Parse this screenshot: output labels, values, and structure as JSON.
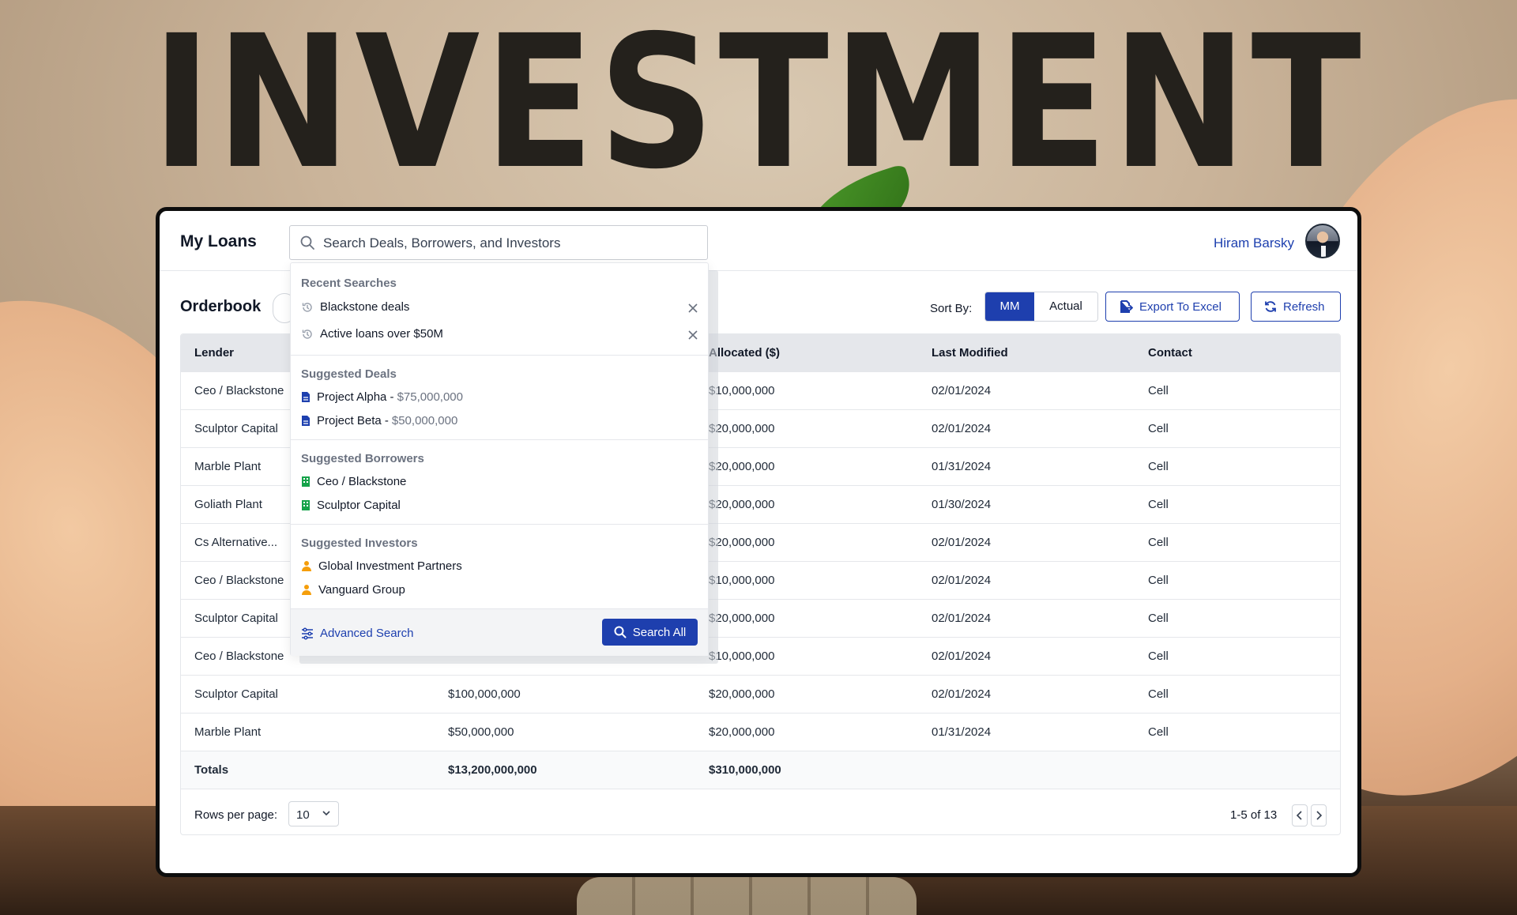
{
  "background": {
    "headline": "INVESTMENT"
  },
  "header": {
    "app_title": "My Loans",
    "search_placeholder": "Search Deals, Borrowers, and Investors",
    "user_name": "Hiram Barsky"
  },
  "toolbar": {
    "section_title": "Orderbook",
    "sort_label": "Sort By:",
    "sort_options": [
      "MM",
      "Actual"
    ],
    "sort_selected": "MM",
    "export_label": "Export To Excel",
    "refresh_label": "Refresh"
  },
  "table": {
    "columns": [
      "Lender",
      "",
      "Allocated ($)",
      "Last Modified",
      "Contact"
    ],
    "rows": [
      [
        "Ceo / Blackstone",
        "",
        "$10,000,000",
        "02/01/2024",
        "Cell"
      ],
      [
        "Sculptor Capital",
        "",
        "$20,000,000",
        "02/01/2024",
        "Cell"
      ],
      [
        "Marble Plant",
        "",
        "$20,000,000",
        "01/31/2024",
        "Cell"
      ],
      [
        "Goliath Plant",
        "",
        "$20,000,000",
        "01/30/2024",
        "Cell"
      ],
      [
        "Cs Alternative...",
        "",
        "$20,000,000",
        "02/01/2024",
        "Cell"
      ],
      [
        "Ceo / Blackstone",
        "",
        "$10,000,000",
        "02/01/2024",
        "Cell"
      ],
      [
        "Sculptor Capital",
        "",
        "$20,000,000",
        "02/01/2024",
        "Cell"
      ],
      [
        "Ceo / Blackstone",
        "",
        "$10,000,000",
        "02/01/2024",
        "Cell"
      ],
      [
        "Sculptor Capital",
        "$100,000,000",
        "$20,000,000",
        "02/01/2024",
        "Cell"
      ],
      [
        "Marble Plant",
        "$50,000,000",
        "$20,000,000",
        "01/31/2024",
        "Cell"
      ]
    ],
    "totals": [
      "Totals",
      "$13,200,000,000",
      "$310,000,000",
      "",
      ""
    ]
  },
  "pagination": {
    "rows_per_page_label": "Rows per page:",
    "rows_per_page": "10",
    "range": "1-5 of 13"
  },
  "dropdown": {
    "recent_title": "Recent Searches",
    "recent": [
      "Blackstone deals",
      "Active loans over $50M"
    ],
    "deals_title": "Suggested Deals",
    "deals": [
      {
        "name": "Project Alpha - ",
        "amount": "$75,000,000"
      },
      {
        "name": "Project Beta - ",
        "amount": "$50,000,000"
      }
    ],
    "borrowers_title": "Suggested Borrowers",
    "borrowers": [
      "Ceo / Blackstone",
      "Sculptor Capital"
    ],
    "investors_title": "Suggested Investors",
    "investors": [
      "Global Investment Partners",
      "Vanguard Group"
    ],
    "advanced_label": "Advanced Search",
    "search_all_label": "Search All"
  },
  "colors": {
    "primary": "#1e3fae",
    "link": "#1e40af",
    "borrower_icon": "#16a34a",
    "investor_icon": "#f59e0b"
  }
}
